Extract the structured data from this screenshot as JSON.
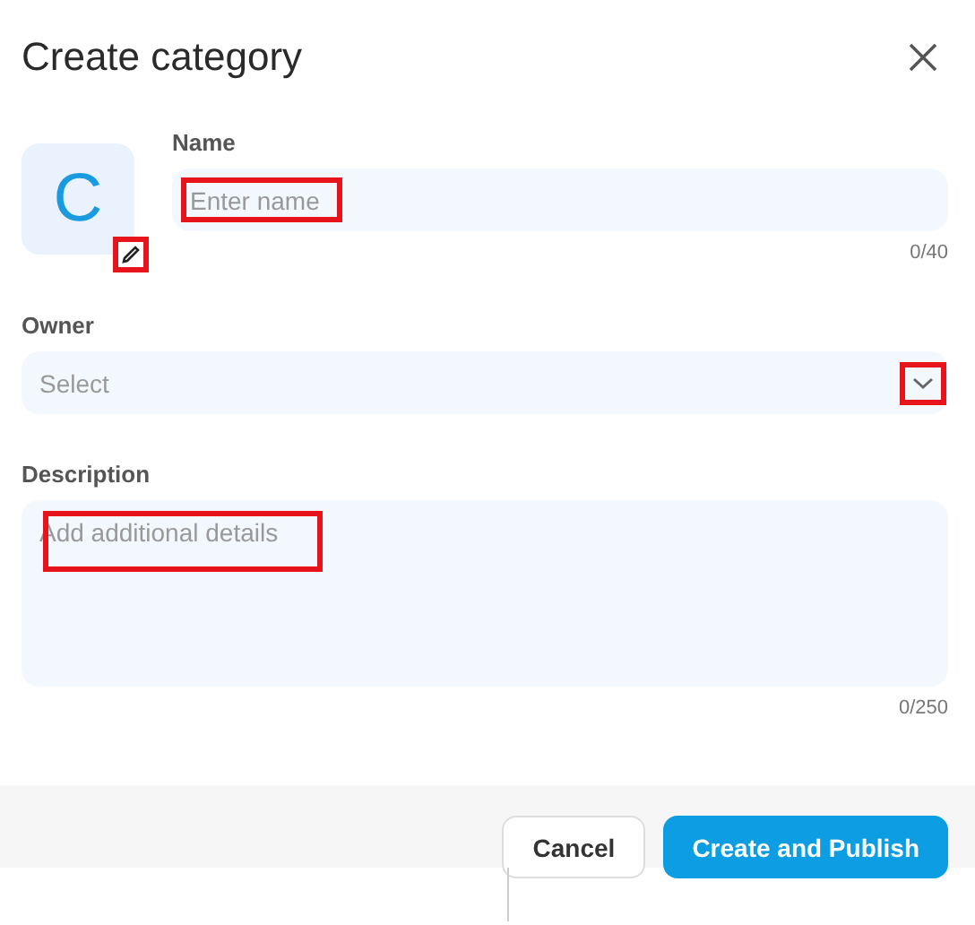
{
  "dialog": {
    "title": "Create category"
  },
  "avatar": {
    "letter": "C",
    "edit_highlighted": true
  },
  "fields": [
    {
      "kind": "text",
      "label": "Name",
      "placeholder": "Enter name",
      "counter": "0/40",
      "highlighted": true
    },
    {
      "kind": "select",
      "label": "Owner",
      "placeholder": "Select",
      "highlighted": true
    },
    {
      "kind": "textarea",
      "label": "Description",
      "placeholder": "Add additional details",
      "counter": "0/250",
      "highlighted": true
    }
  ],
  "buttons": [
    {
      "label": "Cancel",
      "kind": "secondary"
    },
    {
      "label": "Create and Publish",
      "kind": "primary"
    }
  ]
}
